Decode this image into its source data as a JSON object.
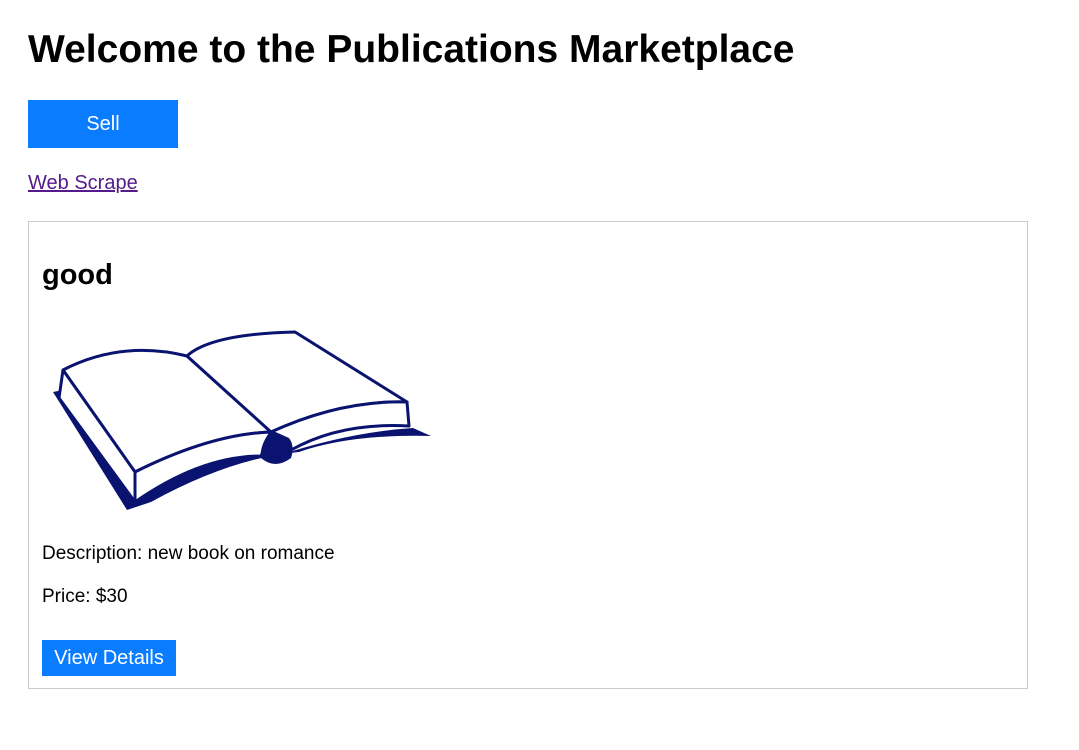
{
  "page": {
    "title": "Welcome to the Publications Marketplace"
  },
  "actions": {
    "sell_label": "Sell",
    "web_scrape_label": "Web Scrape"
  },
  "listing": {
    "title": "good",
    "image_icon": "open-book-icon",
    "description_label": "Description:",
    "description": "new book on romance",
    "price_label": "Price:",
    "price": "$30",
    "details_label": "View Details"
  },
  "colors": {
    "button_blue": "#0a7cff",
    "link_visited": "#551a8b",
    "book_navy": "#0a1470",
    "card_border": "#cccccc"
  }
}
